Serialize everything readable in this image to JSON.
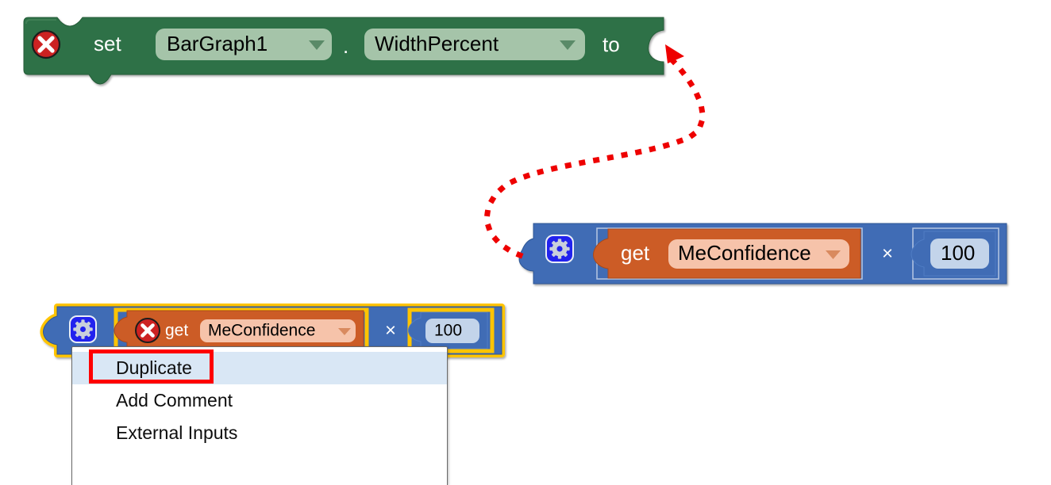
{
  "app": {
    "name": "MIT App Inventor Blocks Editor",
    "background_color": "#ffffff"
  },
  "colors": {
    "setter_block": "#2f7146",
    "setter_block_dark": "#255c39",
    "setter_field_bg": "#a5c4a9",
    "math_block": "#3f6cb5",
    "math_block_dark": "#2f5795",
    "variable_block": "#cc5c25",
    "variable_block_dark": "#a84a1b",
    "variable_field_bg": "#f6c3aa",
    "number_field_bg": "#c3d4ea",
    "selection_highlight": "#ffc400",
    "error_badge": "#cc2222",
    "gear_badge": "#2222ee",
    "arrow_red": "#ee0000",
    "menu_highlight_bg": "#d9e7f5",
    "menu_highlight_border": "#ff0000",
    "menu_bg": "#ffffff",
    "menu_border": "#6a6a6a"
  },
  "setter_block": {
    "name": "set-bargraph1-widthpercent-block",
    "error_icon": "error-x-icon",
    "keyword": "set",
    "component_dropdown": {
      "value": "BarGraph1",
      "arrow": "dropdown-arrow-icon"
    },
    "dot_separator": ".",
    "property_dropdown": {
      "value": "WidthPercent",
      "arrow": "dropdown-arrow-icon"
    },
    "to_keyword": "to",
    "socket": "empty-value-socket"
  },
  "math_block_top": {
    "name": "multiply-block-detached",
    "mutator_icon": "gear-icon",
    "operator": "×",
    "left_operand": {
      "name": "get-variable-block",
      "keyword": "get",
      "variable_dropdown": {
        "value": "MeConfidence",
        "arrow": "dropdown-arrow-icon"
      }
    },
    "right_operand": {
      "name": "number-block",
      "value": "100"
    }
  },
  "math_block_selected": {
    "name": "multiply-block-selected",
    "selected": true,
    "mutator_icon": "gear-icon",
    "operator": "×",
    "left_operand": {
      "name": "get-variable-block",
      "error_icon": "error-x-icon",
      "keyword": "get",
      "variable_dropdown": {
        "value": "MeConfidence",
        "arrow": "dropdown-arrow-icon"
      }
    },
    "right_operand": {
      "name": "number-block",
      "value": "100"
    }
  },
  "context_menu": {
    "name": "block-context-menu",
    "items": [
      {
        "label": "Duplicate",
        "highlighted": true
      },
      {
        "label": "Add Comment",
        "highlighted": false
      },
      {
        "label": "External Inputs",
        "highlighted": false
      }
    ]
  },
  "annotation": {
    "name": "drag-direction-annotation",
    "type": "dotted-curved-arrow",
    "color": "#ee0000",
    "from": "multiply-block-detached-left-plug",
    "to": "set-block-value-socket",
    "highlight_box_target": "Duplicate"
  }
}
